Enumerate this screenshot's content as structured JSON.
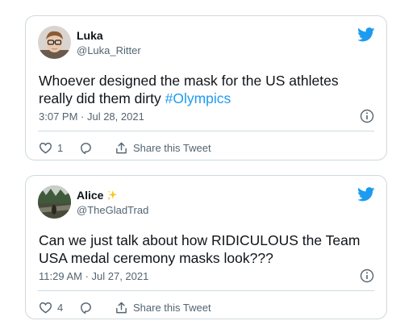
{
  "tweets": [
    {
      "display_name": "Luka",
      "emoji": "",
      "handle": "@Luka_Ritter",
      "text_main": "Whoever designed the mask for the US athletes really did them dirty ",
      "hashtag": "#Olympics",
      "timestamp": "3:07 PM · Jul 28, 2021",
      "like_count": "1",
      "share_label": "Share this Tweet"
    },
    {
      "display_name": "Alice",
      "emoji": "sparkles",
      "handle": "@TheGladTrad",
      "text_main": "Can we just talk about how RIDICULOUS the Team USA medal ceremony masks look???",
      "hashtag": "",
      "timestamp": "11:29 AM · Jul 27, 2021",
      "like_count": "4",
      "share_label": "Share this Tweet"
    }
  ],
  "colors": {
    "twitter_blue": "#1d9bf0",
    "secondary_text": "#536471",
    "border": "#cfd9de",
    "sparkle": "#f5c518"
  },
  "icons": [
    "twitter-bird-icon",
    "info-icon",
    "heart-icon",
    "reply-icon",
    "share-icon",
    "sparkles-icon"
  ]
}
